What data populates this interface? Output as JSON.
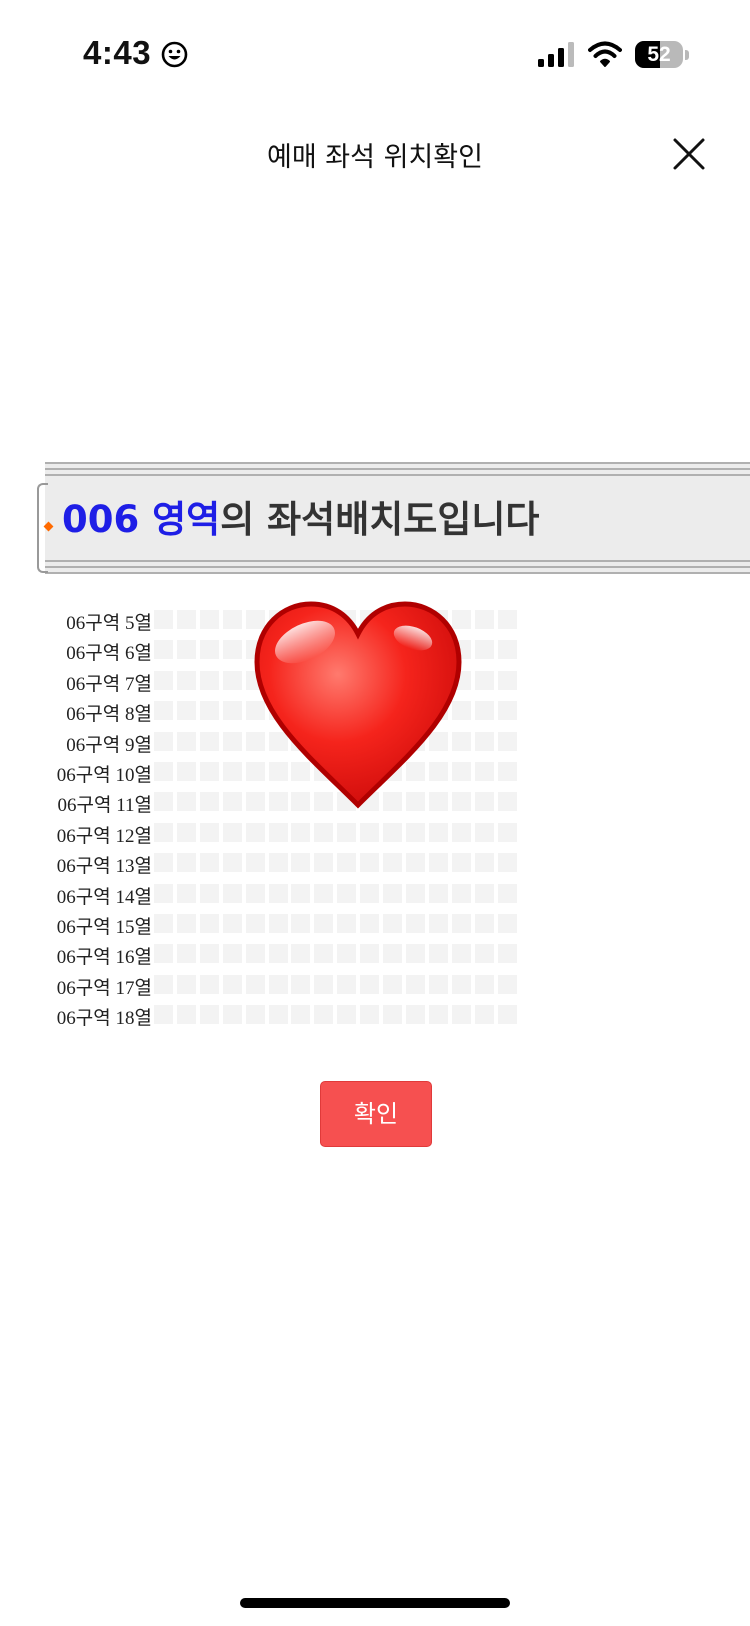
{
  "status_bar": {
    "time": "4:43",
    "battery_level": "52",
    "battery_fraction": 0.52
  },
  "header": {
    "title": "예매 좌석 위치확인",
    "close_icon": "close-icon"
  },
  "banner": {
    "code": "006",
    "area": "영역",
    "rest": "의 좌석배치도입니다"
  },
  "seat_map": {
    "rows": [
      {
        "label": "06구역 5열"
      },
      {
        "label": "06구역 6열"
      },
      {
        "label": "06구역 7열"
      },
      {
        "label": "06구역 8열"
      },
      {
        "label": "06구역 9열"
      },
      {
        "label": "06구역 10열"
      },
      {
        "label": "06구역 11열"
      },
      {
        "label": "06구역 12열"
      },
      {
        "label": "06구역 13열"
      },
      {
        "label": "06구역 14열"
      },
      {
        "label": "06구역 15열"
      },
      {
        "label": "06구역 16열"
      },
      {
        "label": "06구역 17열"
      },
      {
        "label": "06구역 18열"
      }
    ],
    "seats_per_row": 16,
    "seat_color": "#f3f3f3",
    "overlay_icon": "heart-icon"
  },
  "actions": {
    "confirm_label": "확인",
    "confirm_color": "#f65050"
  },
  "colors": {
    "accent_blue": "#1e1ee6",
    "banner_bg": "#ececec",
    "bullet_orange": "#ff6a00"
  }
}
